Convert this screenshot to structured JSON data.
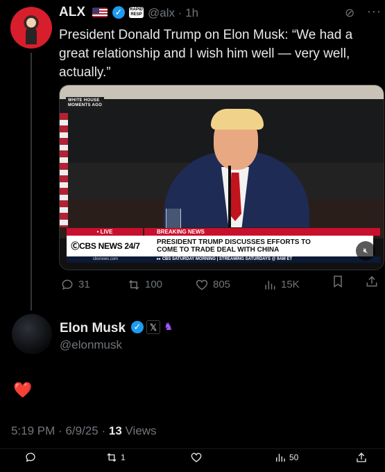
{
  "author": {
    "name": "ALX",
    "handle": "@alx",
    "time": "1h"
  },
  "tweet": {
    "text": "President Donald Trump on Elon Musk: “We had a great relationship and I wish him well — very well, actually.”"
  },
  "media": {
    "corner_label_line1": "WHITE HOUSE",
    "corner_label_line2": "MOMENTS AGO",
    "live_label": "• LIVE",
    "breaking_label": "BREAKING NEWS",
    "network": "ⒸCBS NEWS 24/7",
    "headline_line1": "PRESIDENT TRUMP DISCUSSES EFFORTS TO",
    "headline_line2": "COME TO TRADE DEAL WITH CHINA",
    "url": "cbsnews.com",
    "ticker": "▸▸ CBS SATURDAY MORNING | STREAMING SATURDAYS @ 9AM ET"
  },
  "metrics": {
    "replies": "31",
    "reposts": "100",
    "likes": "805",
    "views": "15K"
  },
  "reply": {
    "name": "Elon Musk",
    "handle": "@elonmusk",
    "text": "❤️"
  },
  "footer": {
    "time": "5:19 PM",
    "date": "6/9/25",
    "views_count": "13",
    "views_label": "Views",
    "separator": "·"
  },
  "bottom_bar": {
    "reposts": "1",
    "views": "50"
  },
  "icons": [
    "flag-icon",
    "verified-icon",
    "grok-icon",
    "more-icon",
    "reply-icon",
    "repost-icon",
    "like-icon",
    "views-icon",
    "bookmark-icon",
    "share-icon",
    "mute-icon",
    "x-badge-icon",
    "affiliate-icon"
  ],
  "colors": {
    "accent": "#1d9bf0",
    "muted": "#71767b",
    "heart": "#e11d48",
    "cbs_red": "#c8102e"
  }
}
